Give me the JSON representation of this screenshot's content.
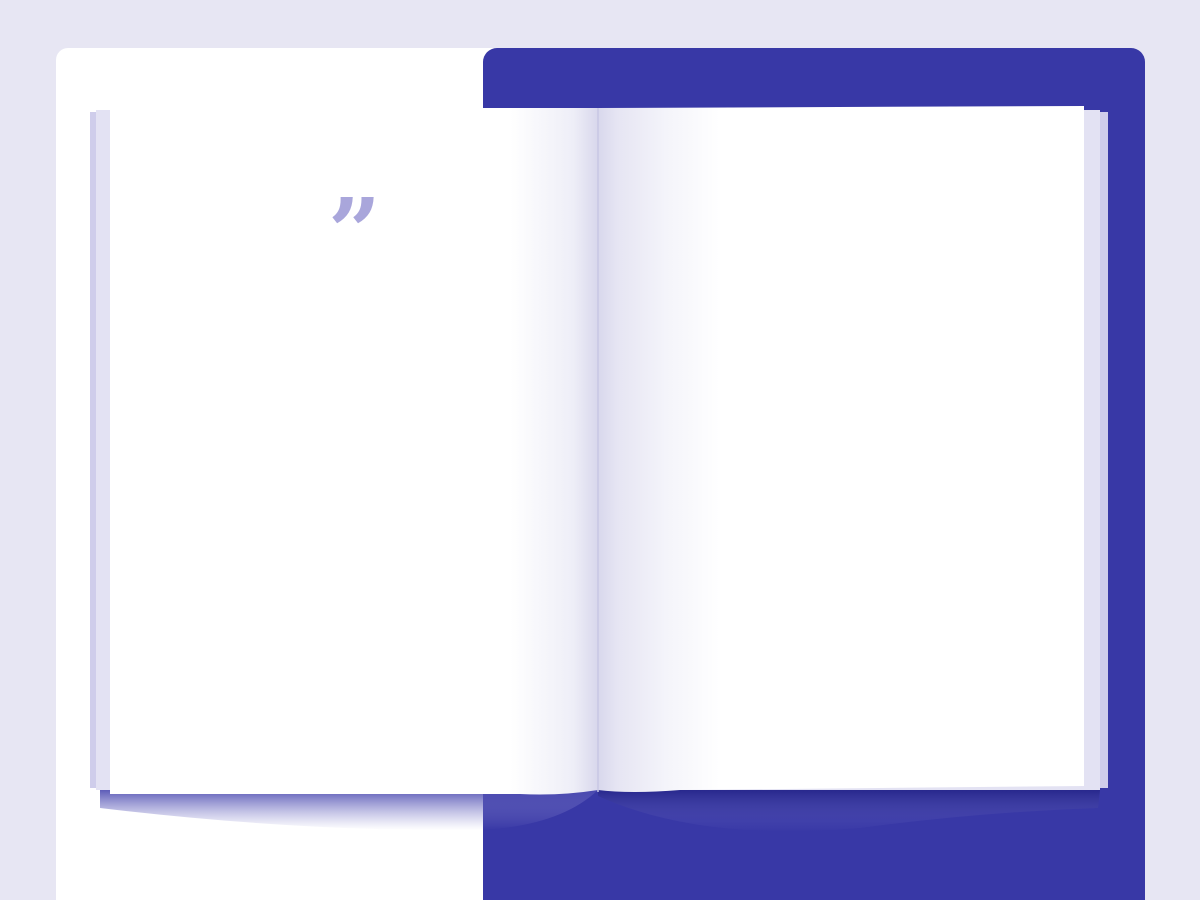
{
  "quote": {
    "mark": "”",
    "icon": "closing-quotation-mark"
  },
  "colors": {
    "background": "#e7e6f3",
    "left_panel": "#ffffff",
    "right_panel": "#3838a6",
    "page_edge": "#cfcdeb",
    "quote": "#a9a6db"
  }
}
